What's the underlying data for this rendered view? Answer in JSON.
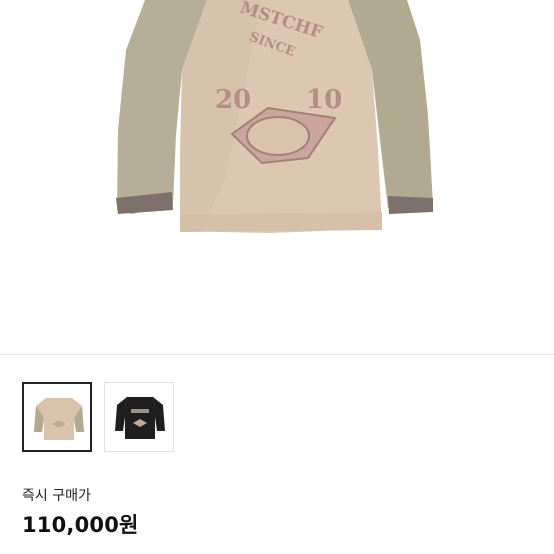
{
  "product": {
    "print_text": {
      "brand": "MSTCHF",
      "since": "SINCE",
      "year_left": "20",
      "year_right": "10"
    }
  },
  "thumbnails": [
    {
      "icon": "beige-sweater-thumbnail",
      "color": "#d9c3ad",
      "selected": true
    },
    {
      "icon": "black-sweater-thumbnail",
      "color": "#1f1f1f",
      "selected": false
    }
  ],
  "purchase": {
    "label": "즉시 구매가",
    "price": "110,000원"
  },
  "colors": {
    "body": "#dcc6b0",
    "sleeve": "#b3ab93",
    "cuff": "#7d6f6a",
    "print": "#b98f88"
  }
}
